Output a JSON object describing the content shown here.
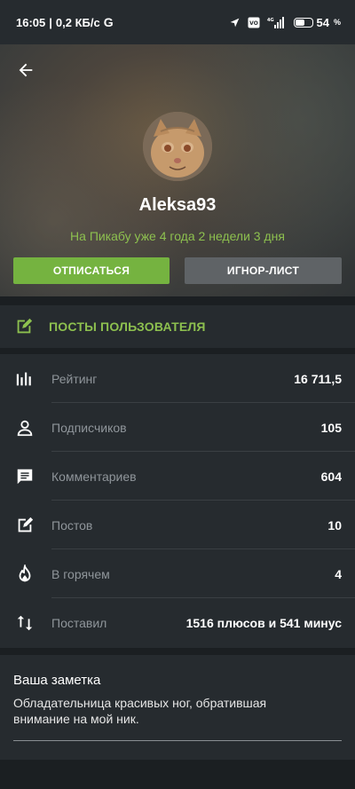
{
  "status_bar": {
    "time": "16:05",
    "speed": "0,2 КБ/с",
    "carrier_icon": "G",
    "battery": "54",
    "battery_unit": "%",
    "network_badge": "4G"
  },
  "profile": {
    "username": "Aleksa93",
    "since": "На Пикабу уже 4 года 2 недели 3 дня",
    "unsubscribe_label": "ОТПИСАТЬСЯ",
    "ignore_label": "ИГНОР-ЛИСТ"
  },
  "posts_link": {
    "label": "ПОСТЫ ПОЛЬЗОВАТЕЛЯ"
  },
  "stats": [
    {
      "icon": "rating-icon",
      "label": "Рейтинг",
      "value": "16 711,5"
    },
    {
      "icon": "person-icon",
      "label": "Подписчиков",
      "value": "105"
    },
    {
      "icon": "comment-icon",
      "label": "Комментариев",
      "value": "604"
    },
    {
      "icon": "edit-icon",
      "label": "Постов",
      "value": "10"
    },
    {
      "icon": "flame-icon",
      "label": "В горячем",
      "value": "4"
    },
    {
      "icon": "swap-icon",
      "label": "Поставил",
      "value": "1516 плюсов и 541 минус"
    }
  ],
  "note": {
    "title": "Ваша заметка",
    "text": "Обладательница красивых ног, обратившая внимание на мой ник."
  },
  "colors": {
    "accent": "#75b340",
    "accent_text": "#8dc04f",
    "background": "#1b1f22",
    "panel": "#262b2f"
  }
}
